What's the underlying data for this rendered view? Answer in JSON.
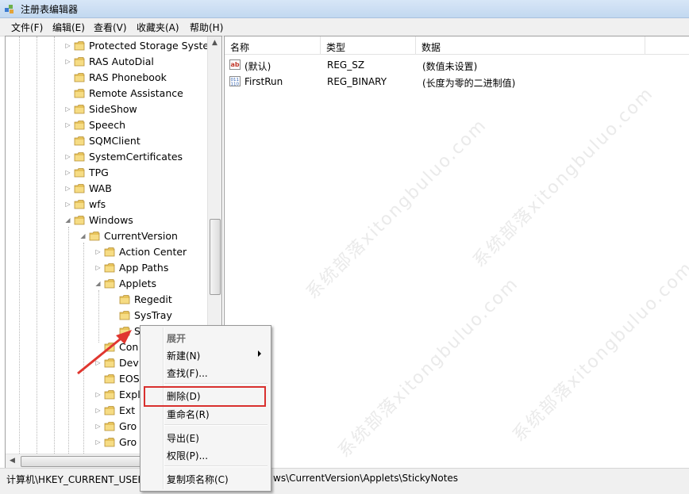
{
  "window": {
    "title": "注册表编辑器"
  },
  "menu": [
    {
      "label": "文件(F)"
    },
    {
      "label": "编辑(E)"
    },
    {
      "label": "查看(V)"
    },
    {
      "label": "收藏夹(A)"
    },
    {
      "label": "帮助(H)"
    }
  ],
  "tree": [
    {
      "label": "Protected Storage System Provider",
      "expander": "collapsed"
    },
    {
      "label": "RAS AutoDial",
      "expander": "collapsed"
    },
    {
      "label": "RAS Phonebook",
      "expander": "none"
    },
    {
      "label": "Remote Assistance",
      "expander": "none"
    },
    {
      "label": "SideShow",
      "expander": "collapsed"
    },
    {
      "label": "Speech",
      "expander": "collapsed"
    },
    {
      "label": "SQMClient",
      "expander": "none"
    },
    {
      "label": "SystemCertificates",
      "expander": "collapsed"
    },
    {
      "label": "TPG",
      "expander": "collapsed"
    },
    {
      "label": "WAB",
      "expander": "collapsed"
    },
    {
      "label": "wfs",
      "expander": "collapsed"
    },
    {
      "label": "Windows",
      "expander": "expanded"
    },
    {
      "label": "CurrentVersion",
      "expander": "expanded"
    },
    {
      "label": "Action Center",
      "expander": "collapsed"
    },
    {
      "label": "App Paths",
      "expander": "collapsed"
    },
    {
      "label": "Applets",
      "expander": "expanded"
    },
    {
      "label": "Regedit",
      "expander": "none"
    },
    {
      "label": "SysTray",
      "expander": "none"
    },
    {
      "label": "S",
      "expander": "none"
    },
    {
      "label": "Con",
      "expander": "none"
    },
    {
      "label": "Dev",
      "expander": "collapsed"
    },
    {
      "label": "EOS",
      "expander": "none"
    },
    {
      "label": "Expl",
      "expander": "collapsed"
    },
    {
      "label": "Ext",
      "expander": "collapsed"
    },
    {
      "label": "Gro",
      "expander": "collapsed"
    },
    {
      "label": "Gro",
      "expander": "collapsed"
    }
  ],
  "columns": {
    "name": "名称",
    "type": "类型",
    "data": "数据"
  },
  "values": [
    {
      "icon": "string-value-icon",
      "name": "(默认)",
      "type": "REG_SZ",
      "data": "(数值未设置)"
    },
    {
      "icon": "binary-value-icon",
      "name": "FirstRun",
      "type": "REG_BINARY",
      "data": "(长度为零的二进制值)"
    }
  ],
  "status": {
    "path_prefix": "计算机\\HKEY_CURRENT_USEF",
    "path_suffix": "ws\\CurrentVersion\\Applets\\StickyNotes"
  },
  "context_menu": {
    "expand": "展开",
    "new": "新建(N)",
    "find": "查找(F)...",
    "delete": "删除(D)",
    "rename": "重命名(R)",
    "export": "导出(E)",
    "permissions": "权限(P)...",
    "copy_key_name": "复制项名称(C)"
  },
  "colors": {
    "highlight_box": "#d9302e",
    "arrow": "#e0362f"
  }
}
